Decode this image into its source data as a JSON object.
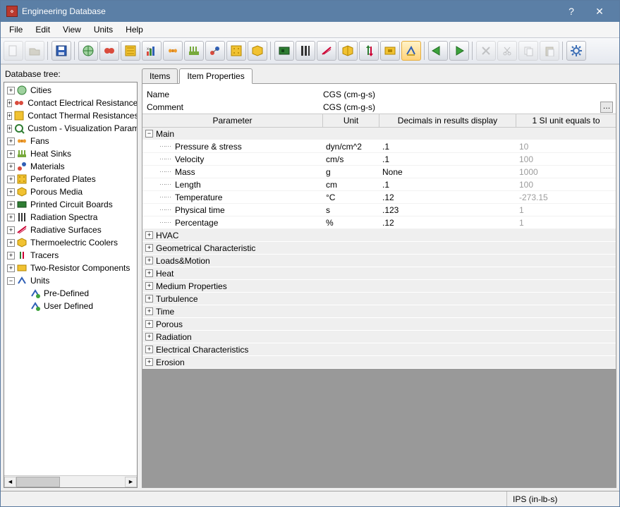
{
  "window": {
    "title": "Engineering Database"
  },
  "menu": {
    "items": [
      "File",
      "Edit",
      "View",
      "Units",
      "Help"
    ]
  },
  "tree": {
    "label": "Database tree:",
    "nodes": [
      {
        "label": "Cities"
      },
      {
        "label": "Contact Electrical Resistances"
      },
      {
        "label": "Contact Thermal Resistances"
      },
      {
        "label": "Custom - Visualization Parameters"
      },
      {
        "label": "Fans"
      },
      {
        "label": "Heat Sinks"
      },
      {
        "label": "Materials"
      },
      {
        "label": "Perforated Plates"
      },
      {
        "label": "Porous Media"
      },
      {
        "label": "Printed Circuit Boards"
      },
      {
        "label": "Radiation Spectra"
      },
      {
        "label": "Radiative Surfaces"
      },
      {
        "label": "Thermoelectric Coolers"
      },
      {
        "label": "Tracers"
      },
      {
        "label": "Two-Resistor Components"
      },
      {
        "label": "Units",
        "expanded": true,
        "children": [
          {
            "label": "Pre-Defined"
          },
          {
            "label": "User Defined"
          }
        ]
      }
    ]
  },
  "tabs": {
    "items": [
      "Items",
      "Item Properties"
    ],
    "active": 1
  },
  "props": {
    "name_label": "Name",
    "name_value": "CGS (cm-g-s)",
    "comment_label": "Comment",
    "comment_value": "CGS (cm-g-s)"
  },
  "headers": {
    "param": "Parameter",
    "unit": "Unit",
    "dec": "Decimals in results display",
    "si": "1 SI unit equals to"
  },
  "main": {
    "label": "Main",
    "rows": [
      {
        "param": "Pressure & stress",
        "unit": "dyn/cm^2",
        "dec": ".1",
        "si": "10"
      },
      {
        "param": "Velocity",
        "unit": "cm/s",
        "dec": ".1",
        "si": "100"
      },
      {
        "param": "Mass",
        "unit": "g",
        "dec": "None",
        "si": "1000"
      },
      {
        "param": "Length",
        "unit": "cm",
        "dec": ".1",
        "si": "100"
      },
      {
        "param": "Temperature",
        "unit": "°C",
        "dec": ".12",
        "si": "-273.15"
      },
      {
        "param": "Physical time",
        "unit": "s",
        "dec": ".123",
        "si": "1"
      },
      {
        "param": "Percentage",
        "unit": "%",
        "dec": ".12",
        "si": "1"
      }
    ]
  },
  "cats": [
    "HVAC",
    "Geometrical Characteristic",
    "Loads&Motion",
    "Heat",
    "Medium Properties",
    "Turbulence",
    "Time",
    "Porous",
    "Radiation",
    "Electrical Characteristics",
    "Erosion"
  ],
  "status": {
    "text": "IPS (in-lb-s)"
  }
}
